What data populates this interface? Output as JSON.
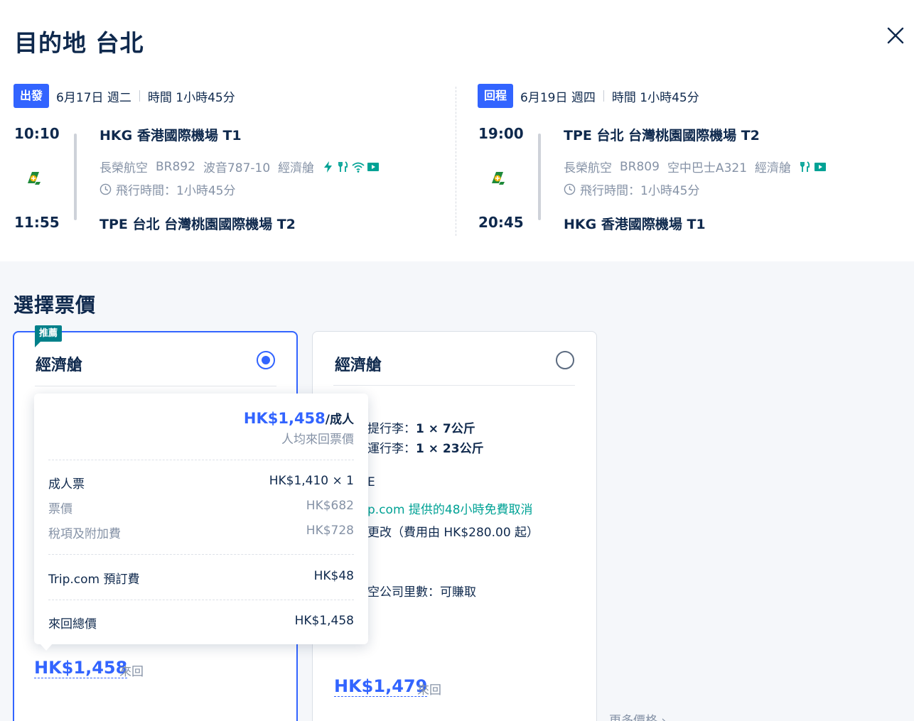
{
  "header": {
    "title": "目的地 台北"
  },
  "outbound": {
    "badge": "出發",
    "date": "6月17日 週二",
    "duration": "時間 1小時45分",
    "dep_time": "10:10",
    "arr_time": "11:55",
    "dep_airport": "HKG 香港國際機場 T1",
    "arr_airport": "TPE 台北 台灣桃園國際機場 T2",
    "airline": "長榮航空",
    "flight_no": "BR892",
    "aircraft": "波音787-10",
    "cabin": "經濟艙",
    "flight_time": "飛行時間：1小時45分",
    "amenities": [
      "power-icon",
      "meal-icon",
      "wifi-icon",
      "entertainment-icon"
    ]
  },
  "return": {
    "badge": "回程",
    "date": "6月19日 週四",
    "duration": "時間 1小時45分",
    "dep_time": "19:00",
    "arr_time": "20:45",
    "dep_airport": "TPE 台北 台灣桃園國際機場 T2",
    "arr_airport": "HKG 香港國際機場 T1",
    "airline": "長榮航空",
    "flight_no": "BR809",
    "aircraft": "空中巴士A321",
    "cabin": "經濟艙",
    "flight_time": "飛行時間：1小時45分",
    "amenities": [
      "meal-icon",
      "entertainment-icon"
    ]
  },
  "fares": {
    "section_title": "選擇票價",
    "cards": [
      {
        "recommend_badge": "推薦",
        "cabin": "經濟艙",
        "selected": true,
        "price": "HK$1,458",
        "price_unit": "來回"
      },
      {
        "cabin": "經濟艙",
        "selected": false,
        "carry_on_label": "提行李：",
        "carry_on_value": "1 × 7公斤",
        "checked_label": "運行李：",
        "checked_value": "1 × 23公斤",
        "policy_partial": "E",
        "free_cancel": "p.com 提供的48小時免費取消",
        "change_fee": "更改（費用由 HK$280.00 起）",
        "miles": "空公司里數：可賺取",
        "price": "HK$1,479",
        "price_unit": "來回"
      }
    ],
    "more_prices": "更多價格"
  },
  "tooltip": {
    "price": "HK$1,458",
    "price_unit": "/成人",
    "sub": "人均來回票價",
    "rows": [
      {
        "label": "成人票",
        "value": "HK$1,410 × 1"
      },
      {
        "label": "票價",
        "value": "HK$682"
      },
      {
        "label": "稅項及附加費",
        "value": "HK$728"
      },
      {
        "label": "Trip.com 預訂費",
        "value": "HK$48"
      },
      {
        "label": "來回總價",
        "value": "HK$1,458"
      }
    ]
  },
  "colors": {
    "accent": "#3264ff",
    "teal": "#00a295",
    "text": "#0f294d",
    "muted": "#8592a6"
  }
}
